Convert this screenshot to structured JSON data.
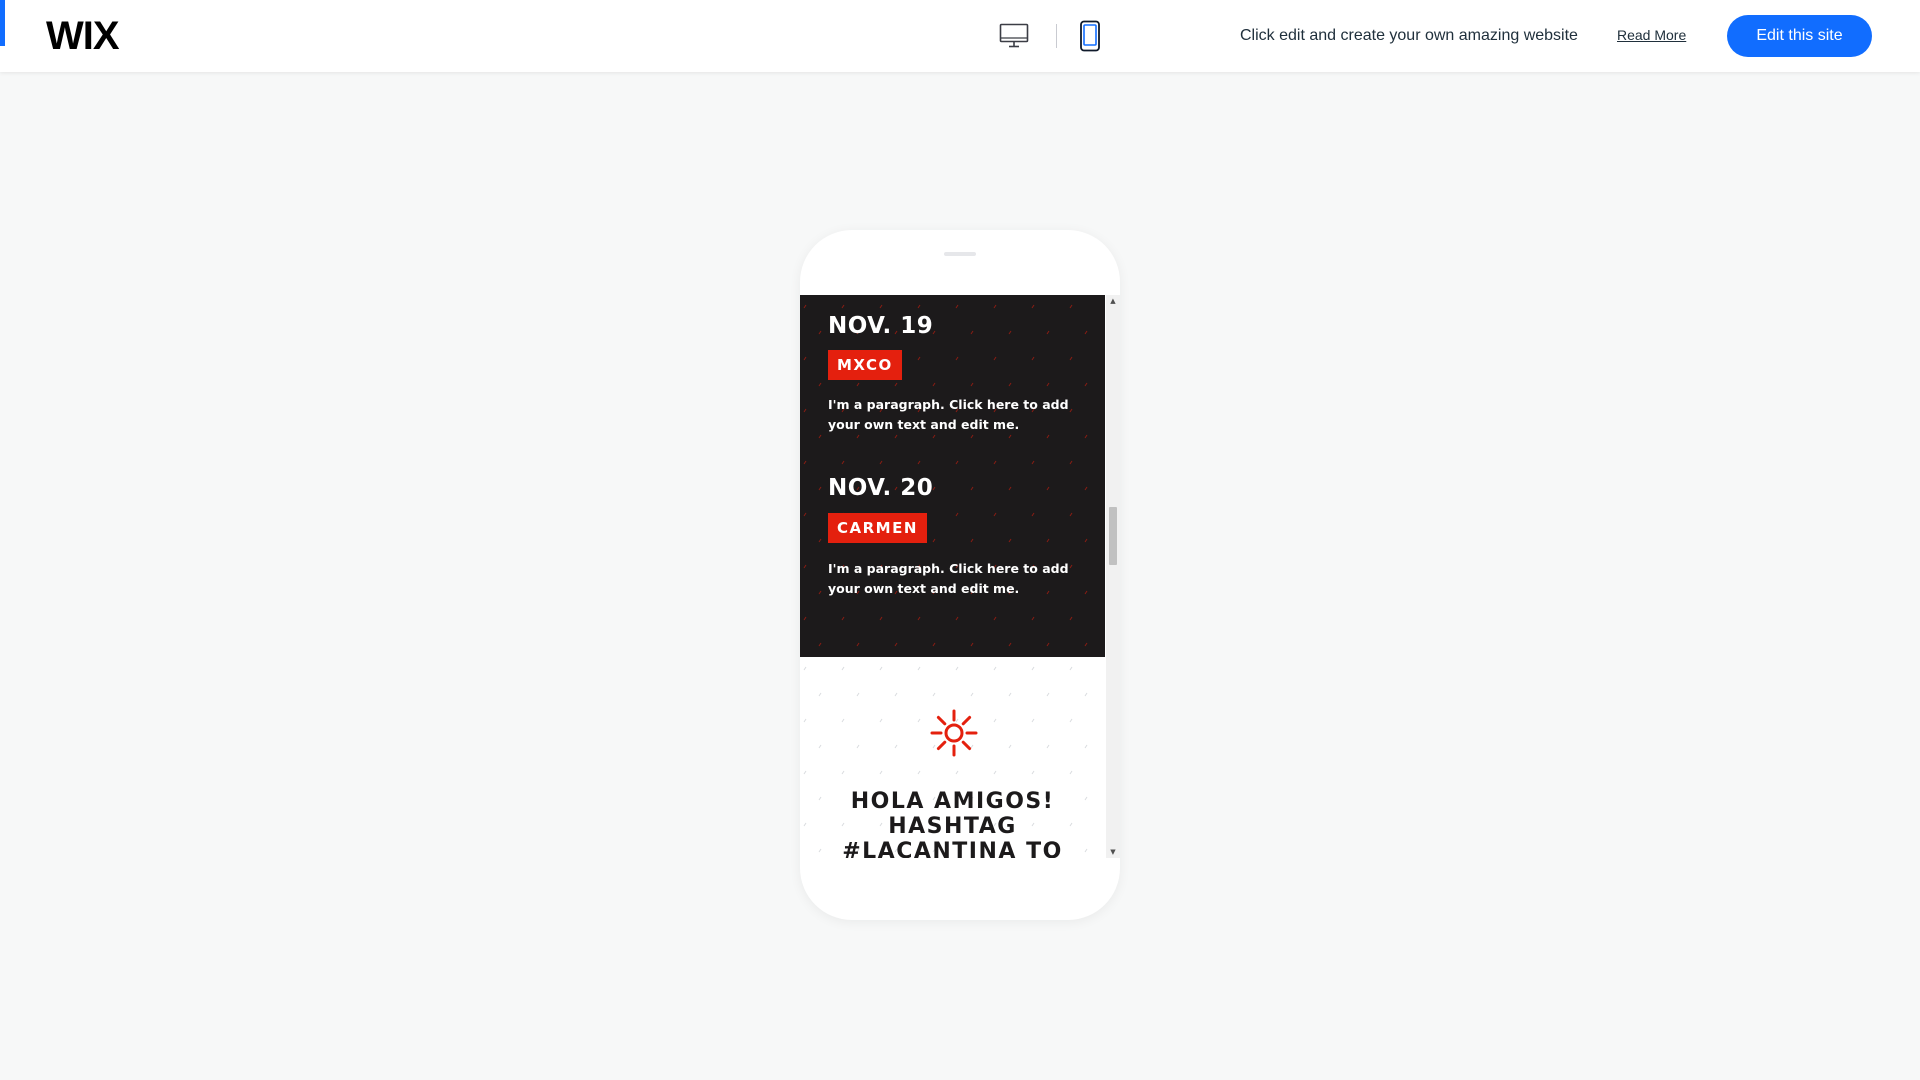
{
  "header": {
    "logo": "WIX",
    "promo_text": "Click edit and create your own amazing website",
    "read_more": "Read More",
    "edit_button": "Edit this site",
    "active_device": "mobile",
    "accent_color": "#116dff"
  },
  "site": {
    "events": [
      {
        "date": "NOV. 19",
        "tag": "MXCO",
        "paragraph": "I'm a paragraph. Click here to add your own text and edit me."
      },
      {
        "date": "NOV. 20",
        "tag": "CARMEN",
        "paragraph": "I'm a paragraph. Click here to add your own text and edit me."
      }
    ],
    "heading": "HOLA AMIGOS! HASHTAG #LACANTINA TO",
    "icon": "sun-icon",
    "colors": {
      "dark_bg": "#1c1a1b",
      "accent_red": "#e4200e"
    }
  }
}
